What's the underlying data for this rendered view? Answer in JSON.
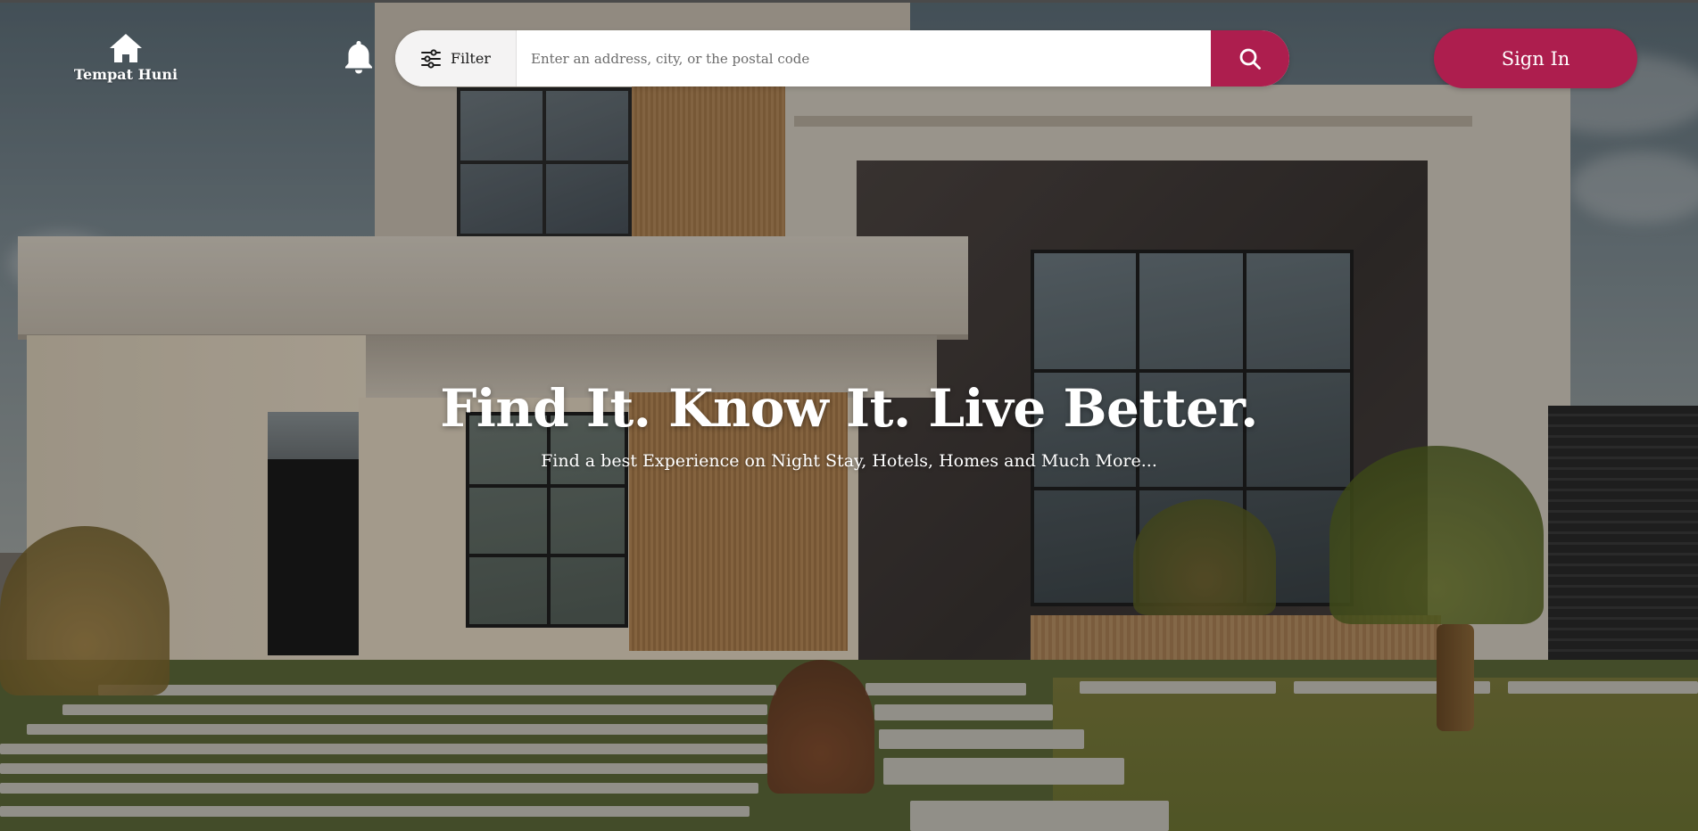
{
  "brand": {
    "name": "Tempat Huni",
    "icon": "home-icon"
  },
  "header": {
    "notification_icon": "bell-icon",
    "filter": {
      "label": "Filter",
      "icon": "sliders-icon"
    },
    "search": {
      "placeholder": "Enter an address, city, or the postal code",
      "value": "",
      "icon": "search-icon"
    },
    "signin_label": "Sign In"
  },
  "hero": {
    "title": "Find It. Know It. Live Better.",
    "subtitle": "Find a best Experience on Night Stay, Hotels, Homes and Much More..."
  },
  "colors": {
    "accent": "#ad1e4e",
    "text_on_dark": "#ffffff",
    "search_bg": "#ffffff",
    "filter_bg": "#f4f3f3"
  }
}
